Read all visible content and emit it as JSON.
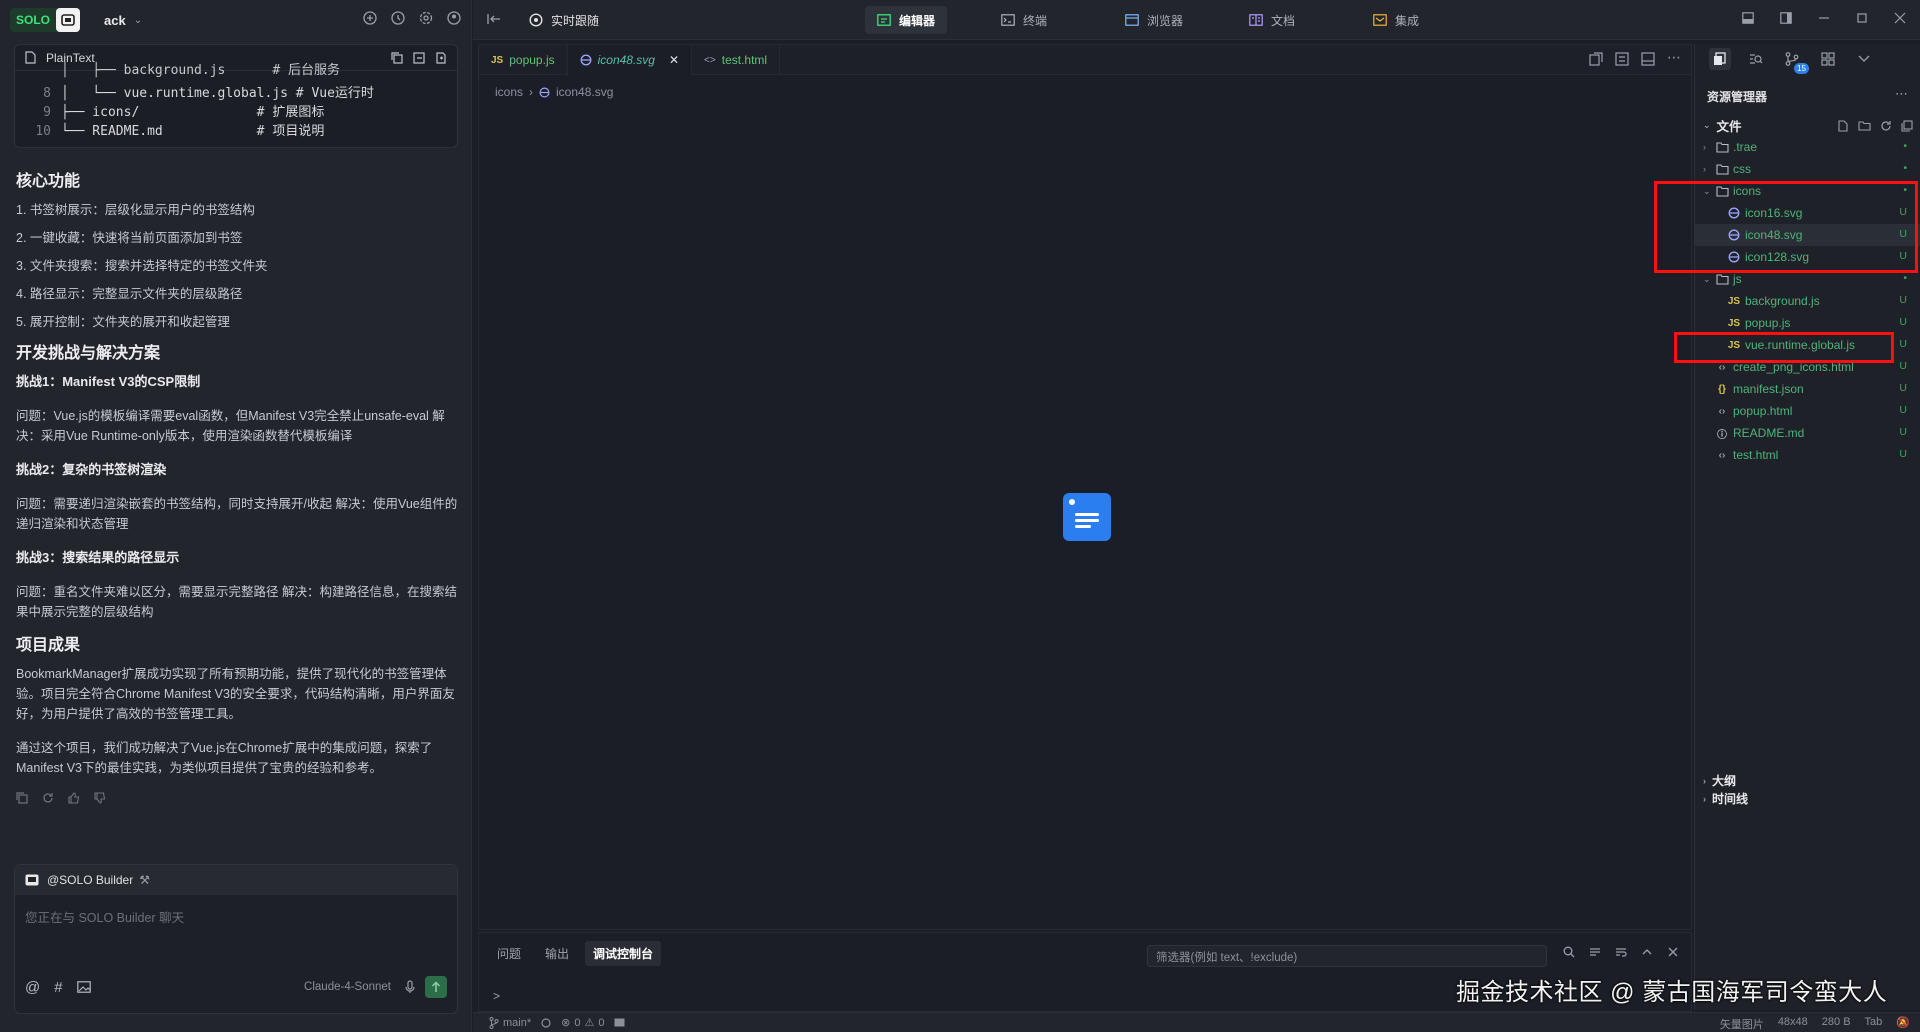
{
  "left_panel": {
    "solo_label": "SOLO",
    "project_name": "ack",
    "code_block": {
      "label": "PlainText",
      "lines": [
        {
          "n": "8",
          "text": "│   └── vue.runtime.global.js # Vue运行时"
        },
        {
          "n": "9",
          "text": "├── icons/               # 扩展图标"
        },
        {
          "n": "10",
          "text": "└── README.md            # 项目说明"
        }
      ],
      "partial_line": "│   ├── background.js      # 后台服务"
    },
    "h_features": "核心功能",
    "features": [
      "1. 书签树展示：层级化显示用户的书签结构",
      "2. 一键收藏：快速将当前页面添加到书签",
      "3. 文件夹搜索：搜索并选择特定的书签文件夹",
      "4. 路径显示：完整显示文件夹的层级路径",
      "5. 展开控制：文件夹的展开和收起管理"
    ],
    "h_challenges": "开发挑战与解决方案",
    "c1_title": "挑战1：Manifest V3的CSP限制",
    "c1_text": "问题：Vue.js的模板编译需要eval函数，但Manifest V3完全禁止unsafe-eval 解决：采用Vue Runtime-only版本，使用渲染函数替代模板编译",
    "c2_title": "挑战2：复杂的书签树渲染",
    "c2_text": "问题：需要递归渲染嵌套的书签结构，同时支持展开/收起 解决：使用Vue组件的递归渲染和状态管理",
    "c3_title": "挑战3：搜索结果的路径显示",
    "c3_text": "问题：重名文件夹难以区分，需要显示完整路径 解决：构建路径信息，在搜索结果中展示完整的层级结构",
    "h_results": "项目成果",
    "r1": "BookmarkManager扩展成功实现了所有预期功能，提供了现代化的书签管理体验。项目完全符合Chrome Manifest V3的安全要求，代码结构清晰，用户界面友好，为用户提供了高效的书签管理工具。",
    "r2": "通过这个项目，我们成功解决了Vue.js在Chrome扩展中的集成问题，探索了Manifest V3下的最佳实践，为类似项目提供了宝贵的经验和参考。",
    "input": {
      "bot_label": "@SOLO Builder",
      "placeholder": "您正在与 SOLO Builder 聊天",
      "model": "Claude-4-Sonnet"
    }
  },
  "topbar": {
    "live_follow": "实时跟随",
    "tabs": [
      "编辑器",
      "终端",
      "浏览器",
      "文档",
      "集成"
    ],
    "active_tab": "编辑器"
  },
  "editor": {
    "tabs": [
      {
        "icon": "JS",
        "label": "popup.js"
      },
      {
        "icon": "svg",
        "label": "icon48.svg"
      },
      {
        "icon": "<>",
        "label": "test.html"
      }
    ],
    "breadcrumb": [
      "icons",
      "icon48.svg"
    ]
  },
  "bottom_panel": {
    "tabs": [
      "问题",
      "输出",
      "调试控制台"
    ],
    "active": "调试控制台",
    "filter_placeholder": "筛选器(例如 text、!exclude)",
    "prompt": ">"
  },
  "statusbar": {
    "branch": "main*",
    "errors": "0",
    "warnings": "0",
    "right": [
      "矢量图片",
      "48x48",
      "280 B",
      "Tab"
    ]
  },
  "explorer": {
    "title": "资源管理器",
    "badge": "15",
    "section": "文件",
    "items": [
      {
        "depth": 0,
        "chev": "›",
        "icon": "folder",
        "name": ".trae",
        "status": "•"
      },
      {
        "depth": 0,
        "chev": "›",
        "icon": "folder",
        "name": "css",
        "status": "•"
      },
      {
        "depth": 0,
        "chev": "⌄",
        "icon": "folder-open",
        "name": "icons",
        "status": "•"
      },
      {
        "depth": 1,
        "chev": "",
        "icon": "svg",
        "name": "icon16.svg",
        "status": "U"
      },
      {
        "depth": 1,
        "chev": "",
        "icon": "svg",
        "name": "icon48.svg",
        "status": "U",
        "selected": true
      },
      {
        "depth": 1,
        "chev": "",
        "icon": "svg",
        "name": "icon128.svg",
        "status": "U"
      },
      {
        "depth": 0,
        "chev": "⌄",
        "icon": "folder-open",
        "name": "js",
        "status": "•"
      },
      {
        "depth": 1,
        "chev": "",
        "icon": "JS",
        "name": "background.js",
        "status": "U"
      },
      {
        "depth": 1,
        "chev": "",
        "icon": "JS",
        "name": "popup.js",
        "status": "U"
      },
      {
        "depth": 1,
        "chev": "",
        "icon": "JS",
        "name": "vue.runtime.global.js",
        "status": "U"
      },
      {
        "depth": 0,
        "chev": "",
        "icon": "<>",
        "name": "create_png_icons.html",
        "status": "U"
      },
      {
        "depth": 0,
        "chev": "",
        "icon": "{}",
        "name": "manifest.json",
        "status": "U"
      },
      {
        "depth": 0,
        "chev": "",
        "icon": "<>",
        "name": "popup.html",
        "status": "U"
      },
      {
        "depth": 0,
        "chev": "",
        "icon": "ⓘ",
        "name": "README.md",
        "status": "U"
      },
      {
        "depth": 0,
        "chev": "",
        "icon": "<>",
        "name": "test.html",
        "status": "U"
      }
    ],
    "outline": "大纲",
    "timeline": "时间线"
  },
  "watermark": "掘金技术社区 @ 蒙古国海军司令蛮大人",
  "colors": {
    "accent_green": "#3ee07a",
    "file_green": "#4fb37a",
    "highlight_red": "#ff1010",
    "doc_blue": "#2a7ef0"
  }
}
